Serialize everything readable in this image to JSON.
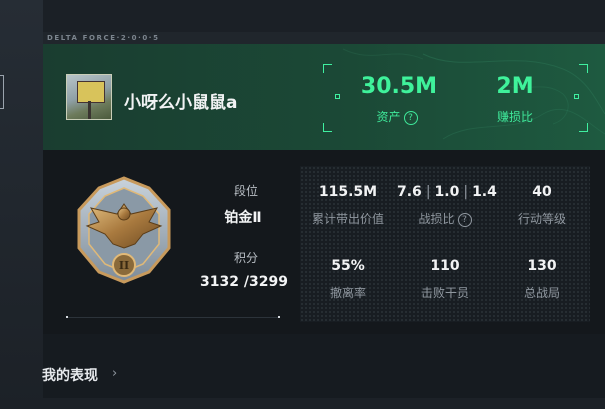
{
  "header": {
    "brand": "DELTA FORCE·2·0·0·5",
    "username": "小呀么小鼠鼠a",
    "assets": {
      "value": "30.5M",
      "label": "资产"
    },
    "ratio": {
      "value": "2M",
      "label": "赚损比"
    }
  },
  "rank": {
    "tier_label": "段位",
    "tier_value": "铂金Ⅱ",
    "points_label": "积分",
    "points_value": "3132 /3299",
    "badge_numeral": "II"
  },
  "stats": [
    {
      "value": "115.5M",
      "label": "累计带出价值"
    },
    {
      "value": [
        "7.6",
        "1.0",
        "1.4"
      ],
      "label": "战损比"
    },
    {
      "value": "40",
      "label": "行动等级"
    },
    {
      "value": "55%",
      "label": "撤离率"
    },
    {
      "value": "110",
      "label": "击败干员"
    },
    {
      "value": "130",
      "label": "总战局"
    }
  ],
  "section": {
    "title": "我的表现",
    "chevron": "›"
  },
  "colors": {
    "accent": "#3ff29b",
    "header_bg": "#1b4936",
    "page_bg": "#161b20"
  },
  "icons": {
    "help": "?"
  }
}
